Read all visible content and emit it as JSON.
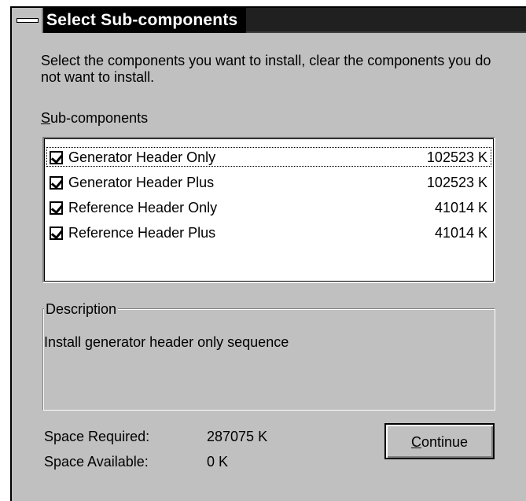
{
  "window": {
    "title": "Select Sub-components",
    "system_menu_icon": "system-menu-icon"
  },
  "instructions": "Select the components you want to install, clear the components you do not want to install.",
  "subcomponents": {
    "label": "Sub-components",
    "items": [
      {
        "name": "Generator Header Only",
        "size": "102523 K",
        "checked": true
      },
      {
        "name": "Generator Header Plus",
        "size": "102523 K",
        "checked": true
      },
      {
        "name": "Reference Header Only",
        "size": "41014 K",
        "checked": true
      },
      {
        "name": "Reference Header Plus",
        "size": "41014 K",
        "checked": true
      }
    ]
  },
  "description": {
    "label": "Description",
    "text": "Install generator header only sequence"
  },
  "space": {
    "required_label": "Space Required:",
    "required_value": "287075 K",
    "available_label": "Space Available:",
    "available_value": "0 K"
  },
  "buttons": {
    "continue_label": "Continue"
  }
}
